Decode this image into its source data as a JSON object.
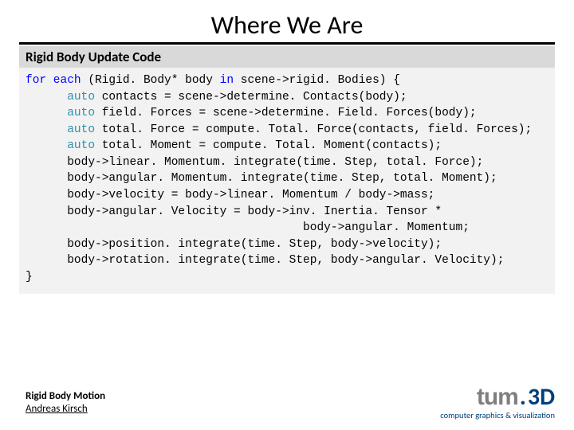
{
  "title": "Where We Are",
  "section_header": "Rigid Body Update Code",
  "code": {
    "l1_a": "for each",
    "l1_b": " (Rigid. Body* body ",
    "l1_c": "in",
    "l1_d": " scene->rigid. Bodies) {",
    "l2_a": "      auto",
    "l2_b": " contacts = scene->determine. Contacts(body);",
    "l3_a": "      auto",
    "l3_b": " field. Forces = scene->determine. Field. Forces(body);",
    "l4_a": "      auto",
    "l4_b": " total. Force = compute. Total. Force(contacts, field. Forces);",
    "l5_a": "      auto",
    "l5_b": " total. Moment = compute. Total. Moment(contacts);",
    "l6": "      body->linear. Momentum. integrate(time. Step, total. Force);",
    "l7": "      body->angular. Momentum. integrate(time. Step, total. Moment);",
    "l8": "      body->velocity = body->linear. Momentum / body->mass;",
    "l9": "      body->angular. Velocity = body->inv. Inertia. Tensor *",
    "l10": "                                        body->angular. Momentum;",
    "l11": "      body->position. integrate(time. Step, body->velocity);",
    "l12": "      body->rotation. integrate(time. Step, body->angular. Velocity);",
    "l13": "}"
  },
  "footer": {
    "line1": "Rigid Body Motion",
    "line2": "Andreas Kirsch"
  },
  "logo": {
    "tum": "tum",
    "dot": ".",
    "d3": "3D",
    "sub": "computer graphics & visualization"
  }
}
